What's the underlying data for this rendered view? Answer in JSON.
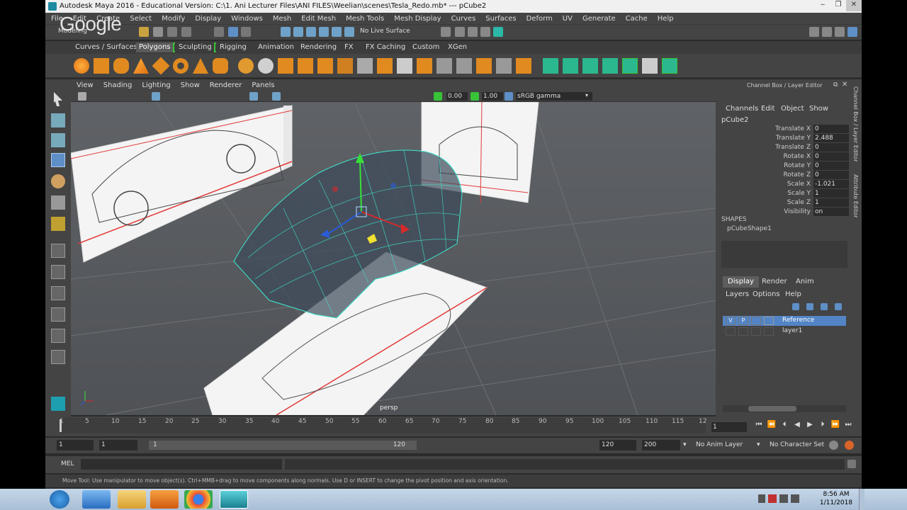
{
  "titlebar": {
    "title": "Autodesk Maya 2016 - Educational Version: C:\\1. Ani Lecturer Files\\ANI FILES\\Weelian\\scenes\\Tesla_Redo.mb*  ---  pCube2",
    "minimize": "‒",
    "maximize": "❐",
    "close": "✕"
  },
  "overlay": {
    "brand": "Google"
  },
  "menubar": [
    "File",
    "Edit",
    "Create",
    "Select",
    "Modify",
    "Display",
    "Windows",
    "Mesh",
    "Edit Mesh",
    "Mesh Tools",
    "Mesh Display",
    "Curves",
    "Surfaces",
    "Deform",
    "UV",
    "Generate",
    "Cache",
    "Help"
  ],
  "statusline": {
    "mode": "Modeling",
    "live_surface": "No Live Surface"
  },
  "shelf": {
    "tabs": [
      "Curves / Surfaces",
      "Polygons",
      "Sculpting",
      "Rigging",
      "Animation",
      "Rendering",
      "FX",
      "FX Caching",
      "Custom",
      "XGen"
    ],
    "active_tab": "Polygons"
  },
  "viewport": {
    "menu": [
      "View",
      "Shading",
      "Lighting",
      "Show",
      "Renderer",
      "Panels"
    ],
    "exposure": "0.00",
    "gamma": "1.00",
    "color_space": "sRGB gamma",
    "camera_label": "persp"
  },
  "channelbox": {
    "title": "Channel Box / Layer Editor",
    "menu": [
      "Channels",
      "Edit",
      "Object",
      "Show"
    ],
    "object": "pCube2",
    "attributes": [
      {
        "label": "Translate X",
        "value": "0"
      },
      {
        "label": "Translate Y",
        "value": "2.488"
      },
      {
        "label": "Translate Z",
        "value": "0"
      },
      {
        "label": "Rotate X",
        "value": "0"
      },
      {
        "label": "Rotate Y",
        "value": "0"
      },
      {
        "label": "Rotate Z",
        "value": "0"
      },
      {
        "label": "Scale X",
        "value": "-1.021"
      },
      {
        "label": "Scale Y",
        "value": "1"
      },
      {
        "label": "Scale Z",
        "value": "1"
      },
      {
        "label": "Visibility",
        "value": "on"
      }
    ],
    "shapes_title": "SHAPES",
    "shape_name": "pCubeShape1",
    "side_tabs": [
      "Channel Box / Layer Editor",
      "Attribute Editor"
    ]
  },
  "layers": {
    "tabs": [
      "Display",
      "Render",
      "Anim"
    ],
    "active_tab": "Display",
    "menu": [
      "Layers",
      "Options",
      "Help"
    ],
    "rows": [
      {
        "name": "Reference",
        "v": "V",
        "p": "P",
        "selected": true
      },
      {
        "name": "layer1",
        "v": "",
        "p": "",
        "selected": false
      }
    ]
  },
  "timeslider": {
    "ticks": [
      "1",
      "5",
      "10",
      "15",
      "20",
      "25",
      "30",
      "35",
      "40",
      "45",
      "50",
      "55",
      "60",
      "65",
      "70",
      "75",
      "80",
      "85",
      "90",
      "95",
      "100",
      "105",
      "110",
      "115",
      "12"
    ],
    "current_frame": "1",
    "controls": [
      "⏮",
      "⏪",
      "⏴",
      "◀",
      "▶",
      "⏵",
      "⏩",
      "⏭"
    ]
  },
  "range": {
    "start": "1",
    "playback_start": "1",
    "bar_start": "1",
    "bar_end": "120",
    "playback_end": "120",
    "end": "200",
    "anim_layer": "No Anim Layer",
    "character_set": "No Character Set"
  },
  "cmdline": {
    "label": "MEL",
    "help": "Move Tool: Use manipulator to move object(s). Ctrl+MMB+drag to move components along normals. Use D or INSERT to change the pivot position and axis orientation."
  },
  "taskbar": {
    "time": "8:56 AM",
    "date": "1/11/2018"
  },
  "colors": {
    "selected_layer": "#5284c6",
    "accent_green": "#38c238",
    "wireframe": "#3de8d0"
  }
}
